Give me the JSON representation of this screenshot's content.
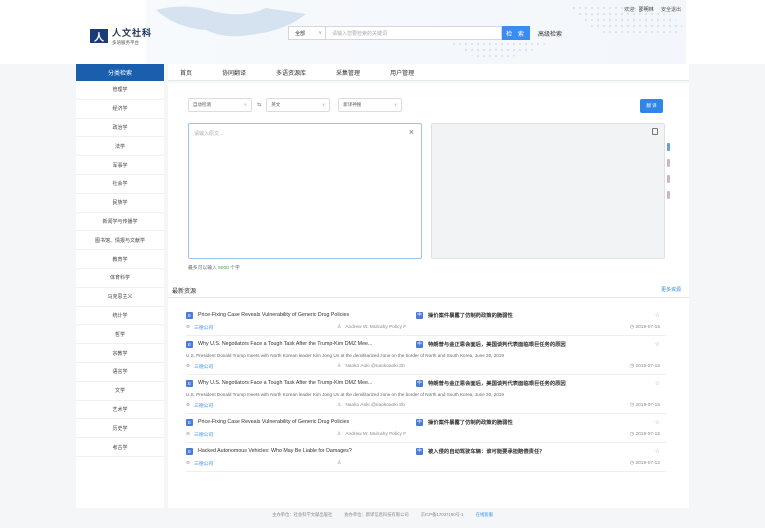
{
  "header": {
    "logo_mark": "人",
    "logo_title": "人文社科",
    "logo_sub": "多语服务平台",
    "welcome": "欢迎:",
    "username": "邵明林",
    "logout": "安全退出"
  },
  "search": {
    "scope": "全部",
    "placeholder": "请输入您要检索的关键词",
    "button": "检 索",
    "advanced": "高级检索"
  },
  "sidebar": {
    "heading": "分类检索",
    "items": [
      "管理学",
      "经济学",
      "政治学",
      "法学",
      "军事学",
      "社会学",
      "民族学",
      "新闻学与传播学",
      "图书馆、情报与文献学",
      "教育学",
      "体育科学",
      "马克思主义",
      "统计学",
      "哲学",
      "宗教学",
      "语言学",
      "文学",
      "艺术学",
      "历史学",
      "考古学"
    ]
  },
  "nav": [
    "首页",
    "协同翻译",
    "多语资源库",
    "采集管理",
    "用户管理"
  ],
  "translate": {
    "source_lang": "自动检测",
    "swap": "⇆",
    "target_lang": "英文",
    "engine": "新译神搜",
    "button": "翻 译",
    "input_placeholder": "请输入原文...",
    "limit_prefix": "最多可以输入",
    "limit_num": "5000",
    "limit_suffix": "个字"
  },
  "latest": {
    "heading": "最新资源",
    "more": "更多资源",
    "items": [
      {
        "en": "Price-Fixing Case Reveals Vulnerability of Generic Drug Policies",
        "zh": "操价案件暴露了仿制药政策的脆弱性",
        "summary": "",
        "publisher": "三德公司",
        "author": "Andrew W. Mulcahy Policy F",
        "date": "2019-07-15"
      },
      {
        "en": "Why U.S. Negotiators Face a Tough Task After the Trump-Kim DMZ Mee...",
        "zh": "特朗普与金正恩会面后，美国谈判代表面临艰巨任务的原因",
        "summary": "U.S. President Donald Trump meets with North Korean leader Kim Jong Un at the demilitarized zone on the border of North and South Korea, June 30, 2019",
        "publisher": "三德公司",
        "author": "Naoko Aoki @naokoaoki Sb",
        "date": "2019-07-15"
      },
      {
        "en": "Why U.S. Negotiators Face a Tough Task After the Trump-Kim DMZ Mee...",
        "zh": "特朗普与金正恩会面后，美国谈判代表面临艰巨任务的原因",
        "summary": "U.S. President Donald Trump meets with North Korean leader Kim Jong Un at the demilitarized zone on the border of North and South Korea, June 30, 2019",
        "publisher": "三德公司",
        "author": "Naoko Aoki @naokoaoki Sb",
        "date": "2019-07-15"
      },
      {
        "en": "Price-Fixing Case Reveals Vulnerability of Generic Drug Policies",
        "zh": "操价案件暴露了仿制药政策的脆弱性",
        "summary": "",
        "publisher": "三德公司",
        "author": "Andrew W. Mulcahy Policy F",
        "date": "2019-07-15"
      },
      {
        "en": "Hacked Autonomous Vehicles: Who May Be Liable for Damages?",
        "zh": "被入侵的自动驾驶车辆：谁可能要承担赔偿责任？",
        "summary": "",
        "publisher": "三德公司",
        "author": "",
        "date": "2019-07-12"
      }
    ]
  },
  "footer": [
    "主办单位：社会科学文献出版社",
    "协办单位：新译信息科技有限公司",
    "京ICP备17037190号-1",
    "在线客服"
  ],
  "colors": {
    "brand": "#1a5fae",
    "accent": "#2f86e8",
    "limit": "#3aa64c"
  }
}
